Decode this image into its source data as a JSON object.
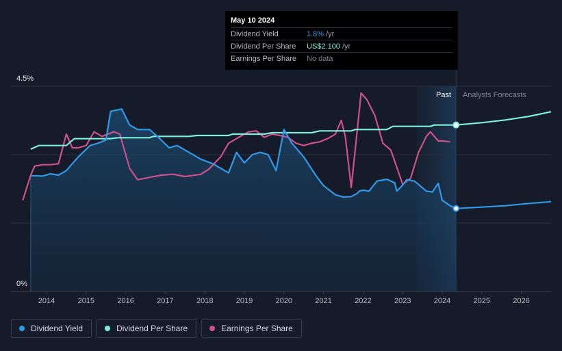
{
  "tooltip": {
    "date": "May 10 2024",
    "rows": [
      {
        "label": "Dividend Yield",
        "value": "1.8%",
        "unit": "/yr",
        "color": "#2f9ae9"
      },
      {
        "label": "Dividend Per Share",
        "value": "US$2.100",
        "unit": "/yr",
        "color": "#7ff0d8"
      },
      {
        "label": "Earnings Per Share",
        "value": "No data",
        "unit": "",
        "color": "#7f8590"
      }
    ]
  },
  "legend": [
    {
      "label": "Dividend Yield",
      "color": "#2f9ae9"
    },
    {
      "label": "Dividend Per Share",
      "color": "#7ff0d8"
    },
    {
      "label": "Earnings Per Share",
      "color": "#d0508c"
    }
  ],
  "colors": {
    "background": "#151b28",
    "yield": "#2f9ae9",
    "dps": "#7ff0d8",
    "eps": "#d0508c",
    "forecast_region": "#1b2a3d",
    "grid": "#2a303c"
  },
  "chart_data": {
    "type": "line",
    "x_range": [
      2013.1,
      2026.75
    ],
    "ylim": [
      0,
      4.5
    ],
    "y_axis_labels": [
      "4.5%",
      "0%"
    ],
    "x_ticks": [
      "2014",
      "2015",
      "2016",
      "2017",
      "2018",
      "2019",
      "2020",
      "2021",
      "2022",
      "2023",
      "2024",
      "2025",
      "2026"
    ],
    "past_label": "Past",
    "forecast_label": "Analysts Forecasts",
    "forecast_start": 2024.35,
    "shade_start": 2023.35,
    "highlight_date": "May 10 2024",
    "series": [
      {
        "name": "Dividend Yield",
        "unit": "%",
        "points": [
          [
            2013.6,
            2.54
          ],
          [
            2013.9,
            2.53
          ],
          [
            2014.1,
            2.58
          ],
          [
            2014.3,
            2.55
          ],
          [
            2014.5,
            2.65
          ],
          [
            2014.8,
            2.95
          ],
          [
            2015.1,
            3.2
          ],
          [
            2015.3,
            3.25
          ],
          [
            2015.5,
            3.32
          ],
          [
            2015.62,
            3.95
          ],
          [
            2015.9,
            4.0
          ],
          [
            2016.1,
            3.65
          ],
          [
            2016.3,
            3.55
          ],
          [
            2016.6,
            3.55
          ],
          [
            2016.8,
            3.4
          ],
          [
            2017.1,
            3.15
          ],
          [
            2017.3,
            3.2
          ],
          [
            2017.5,
            3.1
          ],
          [
            2017.9,
            2.9
          ],
          [
            2018.2,
            2.8
          ],
          [
            2018.4,
            2.7
          ],
          [
            2018.6,
            2.6
          ],
          [
            2018.8,
            3.05
          ],
          [
            2019.0,
            2.82
          ],
          [
            2019.2,
            3.0
          ],
          [
            2019.4,
            3.05
          ],
          [
            2019.6,
            3.0
          ],
          [
            2019.8,
            2.65
          ],
          [
            2020.0,
            3.55
          ],
          [
            2020.2,
            3.25
          ],
          [
            2020.5,
            2.95
          ],
          [
            2020.8,
            2.55
          ],
          [
            2021.0,
            2.32
          ],
          [
            2021.3,
            2.12
          ],
          [
            2021.5,
            2.07
          ],
          [
            2021.7,
            2.08
          ],
          [
            2021.85,
            2.15
          ],
          [
            2021.9,
            2.2
          ],
          [
            2022.0,
            2.22
          ],
          [
            2022.15,
            2.2
          ],
          [
            2022.35,
            2.42
          ],
          [
            2022.6,
            2.46
          ],
          [
            2022.8,
            2.38
          ],
          [
            2022.85,
            2.2
          ],
          [
            2023.0,
            2.33
          ],
          [
            2023.1,
            2.45
          ],
          [
            2023.3,
            2.42
          ],
          [
            2023.6,
            2.2
          ],
          [
            2023.75,
            2.18
          ],
          [
            2023.9,
            2.37
          ],
          [
            2024.0,
            2.0
          ],
          [
            2024.2,
            1.88
          ],
          [
            2024.35,
            1.82
          ],
          [
            2025.0,
            1.85
          ],
          [
            2025.6,
            1.88
          ],
          [
            2026.2,
            1.93
          ],
          [
            2026.75,
            1.97
          ]
        ]
      },
      {
        "name": "Dividend Per Share",
        "unit": "US$",
        "points": [
          [
            2013.6,
            3.12
          ],
          [
            2013.8,
            3.2
          ],
          [
            2014.0,
            3.2
          ],
          [
            2014.5,
            3.2
          ],
          [
            2014.7,
            3.35
          ],
          [
            2015.0,
            3.35
          ],
          [
            2015.6,
            3.35
          ],
          [
            2015.8,
            3.37
          ],
          [
            2016.6,
            3.37
          ],
          [
            2016.7,
            3.4
          ],
          [
            2017.6,
            3.4
          ],
          [
            2017.8,
            3.42
          ],
          [
            2018.6,
            3.42
          ],
          [
            2018.7,
            3.45
          ],
          [
            2019.5,
            3.45
          ],
          [
            2019.7,
            3.48
          ],
          [
            2020.7,
            3.48
          ],
          [
            2020.9,
            3.52
          ],
          [
            2021.7,
            3.52
          ],
          [
            2021.8,
            3.55
          ],
          [
            2022.6,
            3.55
          ],
          [
            2022.75,
            3.62
          ],
          [
            2023.7,
            3.62
          ],
          [
            2023.8,
            3.65
          ],
          [
            2024.35,
            3.65
          ],
          [
            2025.0,
            3.7
          ],
          [
            2025.6,
            3.76
          ],
          [
            2026.2,
            3.84
          ],
          [
            2026.75,
            3.94
          ]
        ]
      },
      {
        "name": "Earnings Per Share",
        "unit": "US$",
        "points": [
          [
            2013.4,
            2.0
          ],
          [
            2013.6,
            2.55
          ],
          [
            2013.7,
            2.75
          ],
          [
            2013.9,
            2.78
          ],
          [
            2014.1,
            2.78
          ],
          [
            2014.3,
            2.8
          ],
          [
            2014.5,
            3.45
          ],
          [
            2014.65,
            3.15
          ],
          [
            2014.8,
            3.15
          ],
          [
            2015.0,
            3.2
          ],
          [
            2015.2,
            3.5
          ],
          [
            2015.4,
            3.4
          ],
          [
            2015.7,
            3.5
          ],
          [
            2015.85,
            3.45
          ],
          [
            2016.1,
            2.7
          ],
          [
            2016.3,
            2.45
          ],
          [
            2016.6,
            2.5
          ],
          [
            2016.9,
            2.55
          ],
          [
            2017.2,
            2.57
          ],
          [
            2017.5,
            2.52
          ],
          [
            2017.9,
            2.57
          ],
          [
            2018.1,
            2.68
          ],
          [
            2018.4,
            2.95
          ],
          [
            2018.6,
            3.25
          ],
          [
            2018.9,
            3.4
          ],
          [
            2019.1,
            3.5
          ],
          [
            2019.3,
            3.52
          ],
          [
            2019.5,
            3.38
          ],
          [
            2019.7,
            3.45
          ],
          [
            2019.9,
            3.42
          ],
          [
            2020.1,
            3.38
          ],
          [
            2020.3,
            3.25
          ],
          [
            2020.5,
            3.2
          ],
          [
            2020.7,
            3.25
          ],
          [
            2020.9,
            3.28
          ],
          [
            2021.1,
            3.35
          ],
          [
            2021.3,
            3.45
          ],
          [
            2021.45,
            3.75
          ],
          [
            2021.55,
            3.4
          ],
          [
            2021.7,
            2.28
          ],
          [
            2021.8,
            3.1
          ],
          [
            2021.95,
            4.35
          ],
          [
            2022.1,
            4.2
          ],
          [
            2022.3,
            3.85
          ],
          [
            2022.5,
            3.25
          ],
          [
            2022.7,
            3.1
          ],
          [
            2022.9,
            2.6
          ],
          [
            2023.0,
            2.35
          ],
          [
            2023.2,
            2.48
          ],
          [
            2023.4,
            3.05
          ],
          [
            2023.6,
            3.4
          ],
          [
            2023.7,
            3.5
          ],
          [
            2023.9,
            3.3
          ],
          [
            2024.0,
            3.3
          ],
          [
            2024.2,
            3.28
          ]
        ]
      }
    ]
  }
}
